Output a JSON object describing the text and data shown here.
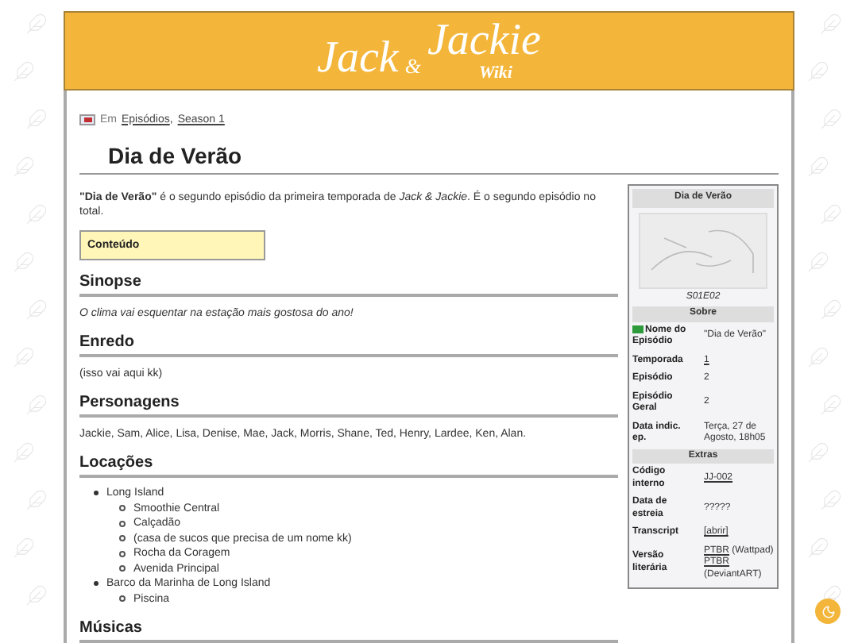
{
  "header": {
    "logo": {
      "name_1": "Jack",
      "ampersand": "&",
      "name_2": "Jackie",
      "subtitle": "Wiki"
    }
  },
  "breadcrumb": {
    "prefix": "Em",
    "separator": ",",
    "links": [
      "Episódios",
      "Season 1"
    ]
  },
  "title": "Dia de Verão",
  "intro": "**\"Dia de Verão\"** é o segundo episódio da primeira temporada de *Jack & Jackie*. É o segundo episódio no total.",
  "toc": {
    "label": "Conteúdo"
  },
  "sections": [
    {
      "heading": "Sinopse",
      "kind": "italic",
      "text": "O clima vai esquentar na estação mais gostosa do ano!"
    },
    {
      "heading": "Enredo",
      "kind": "text",
      "text": "(isso vai aqui kk)"
    },
    {
      "heading": "Personagens",
      "kind": "text",
      "text": "Jackie, Sam, Alice, Lisa, Denise, Mae, Jack, Morris, Shane, Ted, Henry, Lardee, Ken, Alan."
    },
    {
      "heading": "Locações",
      "kind": "list",
      "items": [
        {
          "label": "Long Island",
          "children": [
            {
              "label": "Smoothie Central"
            },
            {
              "label": "Calçadão"
            },
            {
              "label": "(casa de sucos que precisa de um nome kk)"
            },
            {
              "label": "Rocha da Coragem"
            },
            {
              "label": "Avenida Principal"
            }
          ]
        },
        {
          "label": "Barco da Marinha de Long Island",
          "children": [
            {
              "label": "Piscina"
            }
          ]
        }
      ]
    },
    {
      "heading": "Músicas",
      "kind": "empty"
    }
  ],
  "infobox": {
    "title": "Dia de Verão",
    "caption": "S01E02",
    "groups": [
      {
        "heading": "Sobre",
        "rows": [
          {
            "kind": "flag",
            "label": "Nome do Episódio",
            "lines": [
              [
                {
                  "text": "\"Dia de Verão\"",
                  "link": false
                }
              ]
            ]
          },
          {
            "kind": "plain",
            "label": "Temporada",
            "lines": [
              [
                {
                  "text": "1",
                  "link": true
                }
              ]
            ]
          },
          {
            "kind": "plain",
            "label": "Episódio",
            "lines": [
              [
                {
                  "text": "2",
                  "link": false
                }
              ]
            ]
          },
          {
            "kind": "plain",
            "label": "Episódio Geral",
            "lines": [
              [
                {
                  "text": "2",
                  "link": false
                }
              ]
            ]
          },
          {
            "kind": "plain",
            "label": "Data indic. ep.",
            "lines": [
              [
                {
                  "text": "Terça, 27 de Agosto, 18h05",
                  "link": false
                }
              ]
            ]
          }
        ]
      },
      {
        "heading": "Extras",
        "rows": [
          {
            "kind": "plain",
            "label": "Código interno",
            "lines": [
              [
                {
                  "text": "JJ-002",
                  "link": true
                }
              ]
            ]
          },
          {
            "kind": "plain",
            "label": "Data de estreia",
            "lines": [
              [
                {
                  "text": "?????",
                  "link": false
                }
              ]
            ]
          },
          {
            "kind": "plain",
            "label": "Transcript",
            "lines": [
              [
                {
                  "text": "[abrir]",
                  "link": true
                }
              ]
            ]
          },
          {
            "kind": "plain",
            "label": "Versão literária",
            "lines": [
              [
                {
                  "text": "PTBR",
                  "link": true
                },
                {
                  "text": " (Wattpad)",
                  "link": false
                }
              ],
              [
                {
                  "text": "PTBR",
                  "link": true
                },
                {
                  "text": " (DeviantART)",
                  "link": false
                }
              ]
            ]
          }
        ]
      }
    ]
  }
}
